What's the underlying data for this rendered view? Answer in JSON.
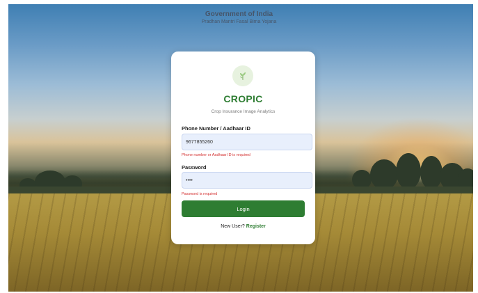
{
  "header": {
    "title": "Government of India",
    "subtitle": "Pradhan Mantri Fasal Bima Yojana"
  },
  "card": {
    "logo_icon": "leaf-icon",
    "brand": "CROPIC",
    "tagline": "Crop Insurance Image Analytics",
    "phone": {
      "label": "Phone Number / Aadhaar ID",
      "value": "9677855260",
      "error": "Phone number or Aadhaar ID is required"
    },
    "password": {
      "label": "Password",
      "value": "••••",
      "error": "Password is required"
    },
    "login_label": "Login",
    "new_user_text": "New User?",
    "register_label": "Register"
  },
  "colors": {
    "primary_green": "#2e7d32",
    "error_red": "#d32f2f",
    "input_bg": "#e8effc"
  }
}
